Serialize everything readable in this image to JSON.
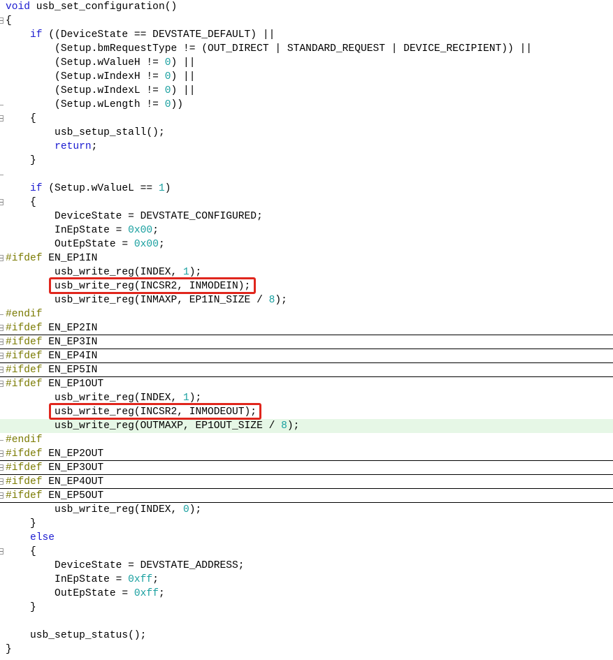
{
  "editor": {
    "language": "c",
    "fold_icon": "fold-toggle-icon",
    "colors": {
      "background": "#ffffff",
      "text": "#000000",
      "keyword": "#1a1ad0",
      "preprocessor": "#7a7a00",
      "number": "#1aa0a0",
      "current_line": "#e6f7e6",
      "annotation_box": "#e0261d"
    },
    "lines": [
      {
        "fold": "",
        "tokens": [
          {
            "t": "void",
            "c": "kw"
          },
          {
            "t": " usb_set_configuration()",
            "c": "id"
          }
        ]
      },
      {
        "fold": "box",
        "tokens": [
          {
            "t": "{",
            "c": "id"
          }
        ]
      },
      {
        "fold": "",
        "tokens": [
          {
            "t": "    ",
            "c": "id"
          },
          {
            "t": "if",
            "c": "kw"
          },
          {
            "t": " ((DeviceState == DEVSTATE_DEFAULT) ||",
            "c": "id"
          }
        ]
      },
      {
        "fold": "",
        "tokens": [
          {
            "t": "        (Setup.bmRequestType != (OUT_DIRECT | STANDARD_REQUEST | DEVICE_RECIPIENT)) ||",
            "c": "id"
          }
        ]
      },
      {
        "fold": "",
        "tokens": [
          {
            "t": "        (Setup.wValueH != ",
            "c": "id"
          },
          {
            "t": "0",
            "c": "num"
          },
          {
            "t": ") ||",
            "c": "id"
          }
        ]
      },
      {
        "fold": "",
        "tokens": [
          {
            "t": "        (Setup.wIndexH != ",
            "c": "id"
          },
          {
            "t": "0",
            "c": "num"
          },
          {
            "t": ") ||",
            "c": "id"
          }
        ]
      },
      {
        "fold": "",
        "tokens": [
          {
            "t": "        (Setup.wIndexL != ",
            "c": "id"
          },
          {
            "t": "0",
            "c": "num"
          },
          {
            "t": ") ||",
            "c": "id"
          }
        ]
      },
      {
        "fold": "end",
        "tokens": [
          {
            "t": "        (Setup.wLength != ",
            "c": "id"
          },
          {
            "t": "0",
            "c": "num"
          },
          {
            "t": "))",
            "c": "id"
          }
        ]
      },
      {
        "fold": "box",
        "tokens": [
          {
            "t": "    {",
            "c": "id"
          }
        ]
      },
      {
        "fold": "",
        "tokens": [
          {
            "t": "        usb_setup_stall();",
            "c": "id"
          }
        ]
      },
      {
        "fold": "",
        "tokens": [
          {
            "t": "        ",
            "c": "id"
          },
          {
            "t": "return",
            "c": "kw"
          },
          {
            "t": ";",
            "c": "id"
          }
        ]
      },
      {
        "fold": "",
        "tokens": [
          {
            "t": "    }",
            "c": "id"
          }
        ]
      },
      {
        "fold": "end",
        "tokens": []
      },
      {
        "fold": "",
        "tokens": [
          {
            "t": "    ",
            "c": "id"
          },
          {
            "t": "if",
            "c": "kw"
          },
          {
            "t": " (Setup.wValueL == ",
            "c": "id"
          },
          {
            "t": "1",
            "c": "num"
          },
          {
            "t": ")",
            "c": "id"
          }
        ]
      },
      {
        "fold": "box",
        "tokens": [
          {
            "t": "    {",
            "c": "id"
          }
        ]
      },
      {
        "fold": "",
        "tokens": [
          {
            "t": "        DeviceState = DEVSTATE_CONFIGURED;",
            "c": "id"
          }
        ]
      },
      {
        "fold": "",
        "tokens": [
          {
            "t": "        InEpState = ",
            "c": "id"
          },
          {
            "t": "0x00",
            "c": "num"
          },
          {
            "t": ";",
            "c": "id"
          }
        ]
      },
      {
        "fold": "",
        "tokens": [
          {
            "t": "        OutEpState = ",
            "c": "id"
          },
          {
            "t": "0x00",
            "c": "num"
          },
          {
            "t": ";",
            "c": "id"
          }
        ]
      },
      {
        "fold": "box",
        "tokens": [
          {
            "t": "#ifdef",
            "c": "pp"
          },
          {
            "t": " EN_EP1IN",
            "c": "id"
          }
        ]
      },
      {
        "fold": "",
        "tokens": [
          {
            "t": "        usb_write_reg(INDEX, ",
            "c": "id"
          },
          {
            "t": "1",
            "c": "num"
          },
          {
            "t": ");",
            "c": "id"
          }
        ]
      },
      {
        "fold": "",
        "tokens": [
          {
            "t": "        usb_write_reg(INCSR2, INMODEIN);",
            "c": "id"
          }
        ]
      },
      {
        "fold": "",
        "tokens": [
          {
            "t": "        usb_write_reg(INMAXP, EP1IN_SIZE / ",
            "c": "id"
          },
          {
            "t": "8",
            "c": "num"
          },
          {
            "t": ");",
            "c": "id"
          }
        ]
      },
      {
        "fold": "end",
        "tokens": [
          {
            "t": "#endif",
            "c": "pp"
          }
        ]
      },
      {
        "fold": "box",
        "sep": true,
        "tokens": [
          {
            "t": "#ifdef",
            "c": "pp"
          },
          {
            "t": " EN_EP2IN",
            "c": "id"
          }
        ]
      },
      {
        "fold": "box",
        "sep": true,
        "tokens": [
          {
            "t": "#ifdef",
            "c": "pp"
          },
          {
            "t": " EN_EP3IN",
            "c": "id"
          }
        ]
      },
      {
        "fold": "box",
        "sep": true,
        "tokens": [
          {
            "t": "#ifdef",
            "c": "pp"
          },
          {
            "t": " EN_EP4IN",
            "c": "id"
          }
        ]
      },
      {
        "fold": "box",
        "sep": true,
        "tokens": [
          {
            "t": "#ifdef",
            "c": "pp"
          },
          {
            "t": " EN_EP5IN",
            "c": "id"
          }
        ]
      },
      {
        "fold": "box",
        "tokens": [
          {
            "t": "#ifdef",
            "c": "pp"
          },
          {
            "t": " EN_EP1OUT",
            "c": "id"
          }
        ]
      },
      {
        "fold": "",
        "tokens": [
          {
            "t": "        usb_write_reg(INDEX, ",
            "c": "id"
          },
          {
            "t": "1",
            "c": "num"
          },
          {
            "t": ");",
            "c": "id"
          }
        ]
      },
      {
        "fold": "",
        "tokens": [
          {
            "t": "        usb_write_reg(INCSR2, INMODEOUT);",
            "c": "id"
          }
        ]
      },
      {
        "fold": "",
        "current": true,
        "tokens": [
          {
            "t": "        usb_write_reg(OUTMAXP, EP1OUT_SIZE / ",
            "c": "id"
          },
          {
            "t": "8",
            "c": "num"
          },
          {
            "t": ");",
            "c": "id"
          }
        ]
      },
      {
        "fold": "end",
        "tokens": [
          {
            "t": "#endif",
            "c": "pp"
          }
        ]
      },
      {
        "fold": "box",
        "sep": true,
        "tokens": [
          {
            "t": "#ifdef",
            "c": "pp"
          },
          {
            "t": " EN_EP2OUT",
            "c": "id"
          }
        ]
      },
      {
        "fold": "box",
        "sep": true,
        "tokens": [
          {
            "t": "#ifdef",
            "c": "pp"
          },
          {
            "t": " EN_EP3OUT",
            "c": "id"
          }
        ]
      },
      {
        "fold": "box",
        "sep": true,
        "tokens": [
          {
            "t": "#ifdef",
            "c": "pp"
          },
          {
            "t": " EN_EP4OUT",
            "c": "id"
          }
        ]
      },
      {
        "fold": "box",
        "sep": true,
        "tokens": [
          {
            "t": "#ifdef",
            "c": "pp"
          },
          {
            "t": " EN_EP5OUT",
            "c": "id"
          }
        ]
      },
      {
        "fold": "",
        "tokens": [
          {
            "t": "        usb_write_reg(INDEX, ",
            "c": "id"
          },
          {
            "t": "0",
            "c": "num"
          },
          {
            "t": ");",
            "c": "id"
          }
        ]
      },
      {
        "fold": "",
        "tokens": [
          {
            "t": "    }",
            "c": "id"
          }
        ]
      },
      {
        "fold": "",
        "tokens": [
          {
            "t": "    ",
            "c": "id"
          },
          {
            "t": "else",
            "c": "kw"
          }
        ]
      },
      {
        "fold": "box",
        "tokens": [
          {
            "t": "    {",
            "c": "id"
          }
        ]
      },
      {
        "fold": "",
        "tokens": [
          {
            "t": "        DeviceState = DEVSTATE_ADDRESS;",
            "c": "id"
          }
        ]
      },
      {
        "fold": "",
        "tokens": [
          {
            "t": "        InEpState = ",
            "c": "id"
          },
          {
            "t": "0xff",
            "c": "num"
          },
          {
            "t": ";",
            "c": "id"
          }
        ]
      },
      {
        "fold": "",
        "tokens": [
          {
            "t": "        OutEpState = ",
            "c": "id"
          },
          {
            "t": "0xff",
            "c": "num"
          },
          {
            "t": ";",
            "c": "id"
          }
        ]
      },
      {
        "fold": "",
        "tokens": [
          {
            "t": "    }",
            "c": "id"
          }
        ]
      },
      {
        "fold": "",
        "tokens": []
      },
      {
        "fold": "",
        "tokens": [
          {
            "t": "    usb_setup_status();",
            "c": "id"
          }
        ]
      },
      {
        "fold": "",
        "tokens": [
          {
            "t": "}",
            "c": "id"
          }
        ]
      }
    ]
  },
  "annotations": [
    {
      "name": "inmodein-callout",
      "line": 20,
      "text": "usb_write_reg(INCSR2, INMODEIN);"
    },
    {
      "name": "inmodeout-callout",
      "line": 29,
      "text": "usb_write_reg(INCSR2, INMODEOUT);"
    }
  ]
}
